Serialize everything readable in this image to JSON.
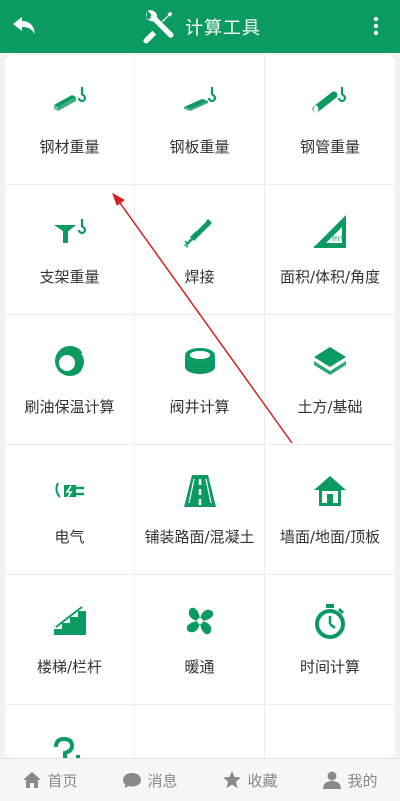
{
  "header": {
    "title": "计算工具",
    "back_icon": "back-arrow-icon",
    "title_icon": "tools-icon",
    "more_icon": "more-vertical-icon"
  },
  "colors": {
    "primary": "#0c9a63",
    "annotation_arrow": "#d32020"
  },
  "tools": [
    {
      "label": "钢材重量",
      "icon": "steel-bar-hook-icon"
    },
    {
      "label": "钢板重量",
      "icon": "steel-plate-hook-icon"
    },
    {
      "label": "钢管重量",
      "icon": "steel-pipe-hook-icon"
    },
    {
      "label": "支架重量",
      "icon": "bracket-hook-icon"
    },
    {
      "label": "焊接",
      "icon": "welding-torch-icon"
    },
    {
      "label": "面积/体积/角度",
      "icon": "area-ruler-icon"
    },
    {
      "label": "刷油保温计算",
      "icon": "insulation-ring-icon"
    },
    {
      "label": "阀井计算",
      "icon": "valve-well-icon"
    },
    {
      "label": "土方/基础",
      "icon": "earthwork-layers-icon"
    },
    {
      "label": "电气",
      "icon": "electric-plug-icon"
    },
    {
      "label": "铺装路面/混凝土",
      "icon": "road-paving-icon"
    },
    {
      "label": "墙面/地面/顶板",
      "icon": "house-icon"
    },
    {
      "label": "楼梯/栏杆",
      "icon": "stairs-icon"
    },
    {
      "label": "暖通",
      "icon": "fan-icon"
    },
    {
      "label": "时间计算",
      "icon": "stopwatch-icon"
    },
    {
      "label": "",
      "icon": "more-tools-icon"
    }
  ],
  "bottom_nav": [
    {
      "label": "首页",
      "icon": "home-icon"
    },
    {
      "label": "消息",
      "icon": "chat-bubble-icon"
    },
    {
      "label": "收藏",
      "icon": "star-icon"
    },
    {
      "label": "我的",
      "icon": "user-icon"
    }
  ]
}
